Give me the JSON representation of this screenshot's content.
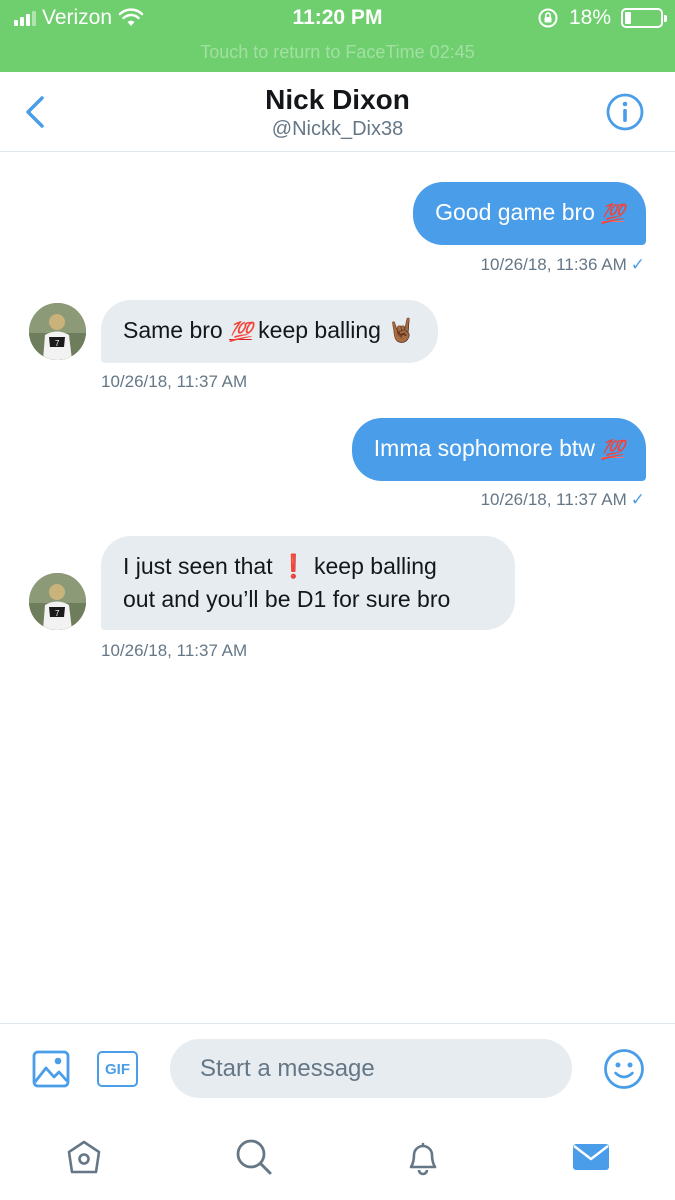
{
  "status_bar": {
    "carrier": "Verizon",
    "time": "11:20 PM",
    "battery_percent": "18%",
    "battery_level": 0.18,
    "banner": "Touch to return to FaceTime 02:45",
    "background_color": "#6fcf6f"
  },
  "header": {
    "title": "Nick Dixon",
    "handle": "@Nickk_Dix38",
    "back_icon": "chevron-left-icon",
    "info_icon": "info-icon"
  },
  "conversation": {
    "messages": [
      {
        "direction": "outgoing",
        "text": "Good game bro",
        "emoji": "💯",
        "timestamp": "10/26/18, 11:36 AM",
        "read_check": "✓"
      },
      {
        "direction": "incoming",
        "text_before": "Same bro",
        "emoji1": "💯",
        "text_after": "keep balling",
        "emoji2": "🤘🏾",
        "timestamp": "10/26/18, 11:37 AM"
      },
      {
        "direction": "outgoing",
        "text": "Imma sophomore btw",
        "emoji": "💯",
        "timestamp": "10/26/18, 11:37 AM",
        "read_check": "✓"
      },
      {
        "direction": "incoming",
        "line1_before": "I just seen that",
        "emoji": "❗",
        "line1_after": "keep balling",
        "line2": "out and you’ll be D1 for sure bro",
        "timestamp": "10/26/18, 11:37 AM"
      }
    ]
  },
  "composer": {
    "placeholder": "Start a message",
    "gif_label": "GIF",
    "image_icon": "image-icon",
    "emoji_icon": "smiley-icon"
  },
  "tab_bar": {
    "items": [
      "home-icon",
      "search-icon",
      "notifications-icon",
      "messages-icon"
    ],
    "active": "messages-icon"
  },
  "colors": {
    "accent": "#4a9de9",
    "incoming_bubble": "#e6ecf0",
    "secondary_text": "#657786"
  }
}
